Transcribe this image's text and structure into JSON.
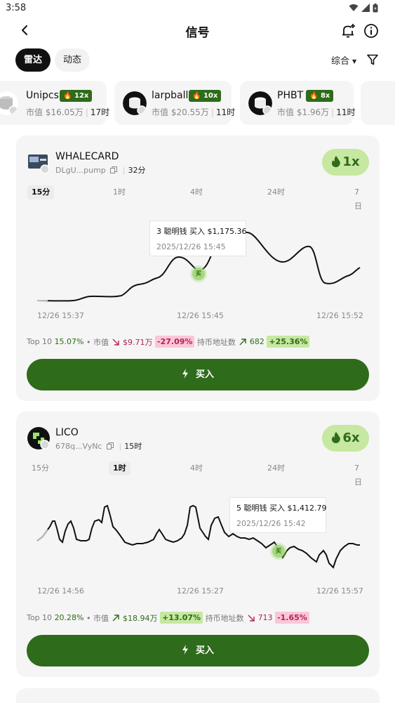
{
  "status_bar": {
    "time": "3:58"
  },
  "header": {
    "title": "信号"
  },
  "tabs": [
    {
      "label": "雷达",
      "active": true
    },
    {
      "label": "动态",
      "active": false
    }
  ],
  "sort": {
    "label": "综合"
  },
  "chips": [
    {
      "name": "Unipcs",
      "badge": "12x",
      "market_cap": "市值 $16.05万",
      "age": "17时"
    },
    {
      "name": "larpball",
      "badge": "10x",
      "market_cap": "市值 $20.55万",
      "age": "11时"
    },
    {
      "name": "PHBT",
      "badge": "8x",
      "market_cap": "市值 $1.96万",
      "age": "11时"
    }
  ],
  "cards": [
    {
      "name": "WHALECARD",
      "address": "DLgU...pump",
      "age": "32分",
      "multiplier": "1x",
      "ranges": [
        "15分",
        "1时",
        "4时",
        "24时",
        "7日"
      ],
      "active_range": 0,
      "tooltip": {
        "line1": "3 聪明钱 买入 $1,175.36",
        "line2": "2025/12/26 15:45"
      },
      "buy_marker": "买",
      "axis": [
        "12/26 15:37",
        "12/26 15:45",
        "12/26 15:52"
      ],
      "stats": {
        "top10_label": "Top 10",
        "top10_value": "15.07%",
        "mcap_label": "• 市值",
        "mcap_value": "$9.71万",
        "mcap_change": "-27.09%",
        "holders_label": "持币地址数",
        "holders_value": "682",
        "holders_change": "+25.36%"
      },
      "buy_label": "买入"
    },
    {
      "name": "LICO",
      "address": "678q...VyNc",
      "age": "15时",
      "multiplier": "6x",
      "ranges": [
        "15分",
        "1时",
        "4时",
        "24时",
        "7日"
      ],
      "active_range": 1,
      "tooltip": {
        "line1": "5 聪明钱 买入 $1,412.79",
        "line2": "2025/12/26 15:42"
      },
      "buy_marker": "买",
      "axis": [
        "12/26 14:56",
        "12/26 15:27",
        "12/26 15:57"
      ],
      "stats": {
        "top10_label": "Top 10",
        "top10_value": "20.28%",
        "mcap_label": "• 市值",
        "mcap_value": "$18.94万",
        "mcap_change": "+13.07%",
        "holders_label": "持币地址数",
        "holders_value": "713",
        "holders_change": "-1.65%"
      },
      "buy_label": "买入"
    }
  ],
  "colors": {
    "accent": "#2e6b1a",
    "badge_bg": "#c6e8a0",
    "negative": "#b2254f",
    "negative_bg": "#fbc6d8",
    "card_bg": "#f5f5f5"
  }
}
